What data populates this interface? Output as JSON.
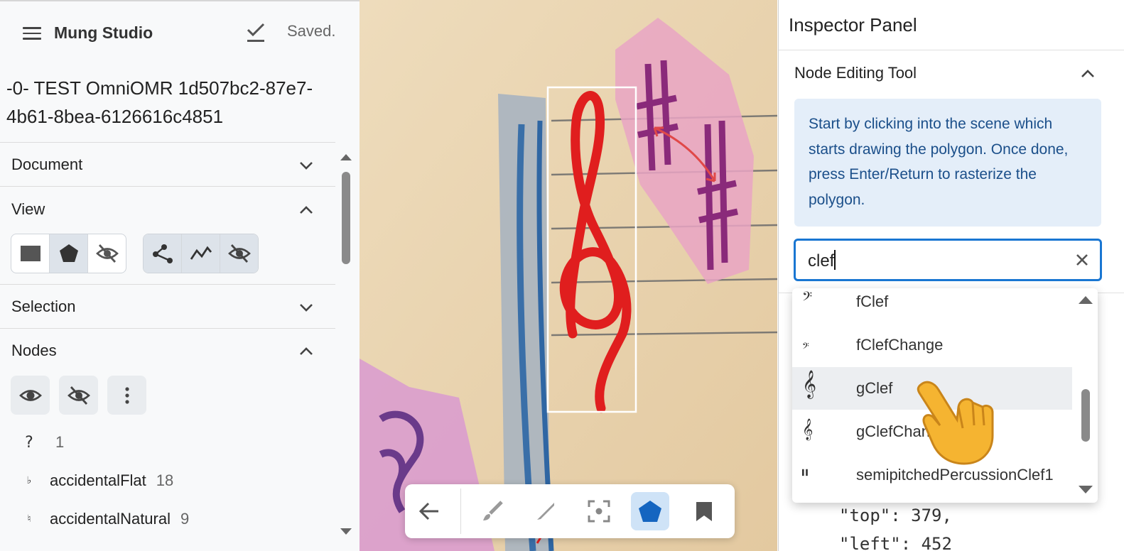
{
  "header": {
    "app_title": "Mung Studio",
    "save_status": "Saved."
  },
  "document": {
    "name": "-0- TEST OmniOMR 1d507bc2-87e7-4b61-8bea-6126616c4851"
  },
  "sections": {
    "document": "Document",
    "view": "View",
    "selection": "Selection",
    "nodes": "Nodes"
  },
  "nodes": [
    {
      "icon": "?",
      "name": "",
      "count": "1"
    },
    {
      "icon": "♭",
      "name": "accidentalFlat",
      "count": "18"
    },
    {
      "icon": "♮",
      "name": "accidentalNatural",
      "count": "9"
    }
  ],
  "inspector": {
    "title": "Inspector Panel",
    "tool_title": "Node Editing Tool",
    "info": "Start by clicking into the scene which starts drawing the polygon. Once done, press Enter/Return to rasterize the polygon.",
    "search_value": "clef",
    "json_line1": "\"top\": 379,",
    "json_line2": "\"left\": 452"
  },
  "dropdown": {
    "items": [
      {
        "glyph": "𝄢",
        "label": "fClef",
        "selected": false
      },
      {
        "glyph": "𝄢",
        "label": "fClefChange",
        "selected": false
      },
      {
        "glyph": "𝄞",
        "label": "gClef",
        "selected": true
      },
      {
        "glyph": "𝄞",
        "label": "gClefChange",
        "selected": false
      },
      {
        "glyph": "𝄥",
        "label": "semipitchedPercussionClef1",
        "selected": false
      }
    ]
  },
  "colors": {
    "accent": "#1976d2",
    "info_bg": "#e4eef9",
    "info_text": "#1b4f8a",
    "active_tool": "#cfe3f7",
    "tool_blue": "#1565c0"
  }
}
